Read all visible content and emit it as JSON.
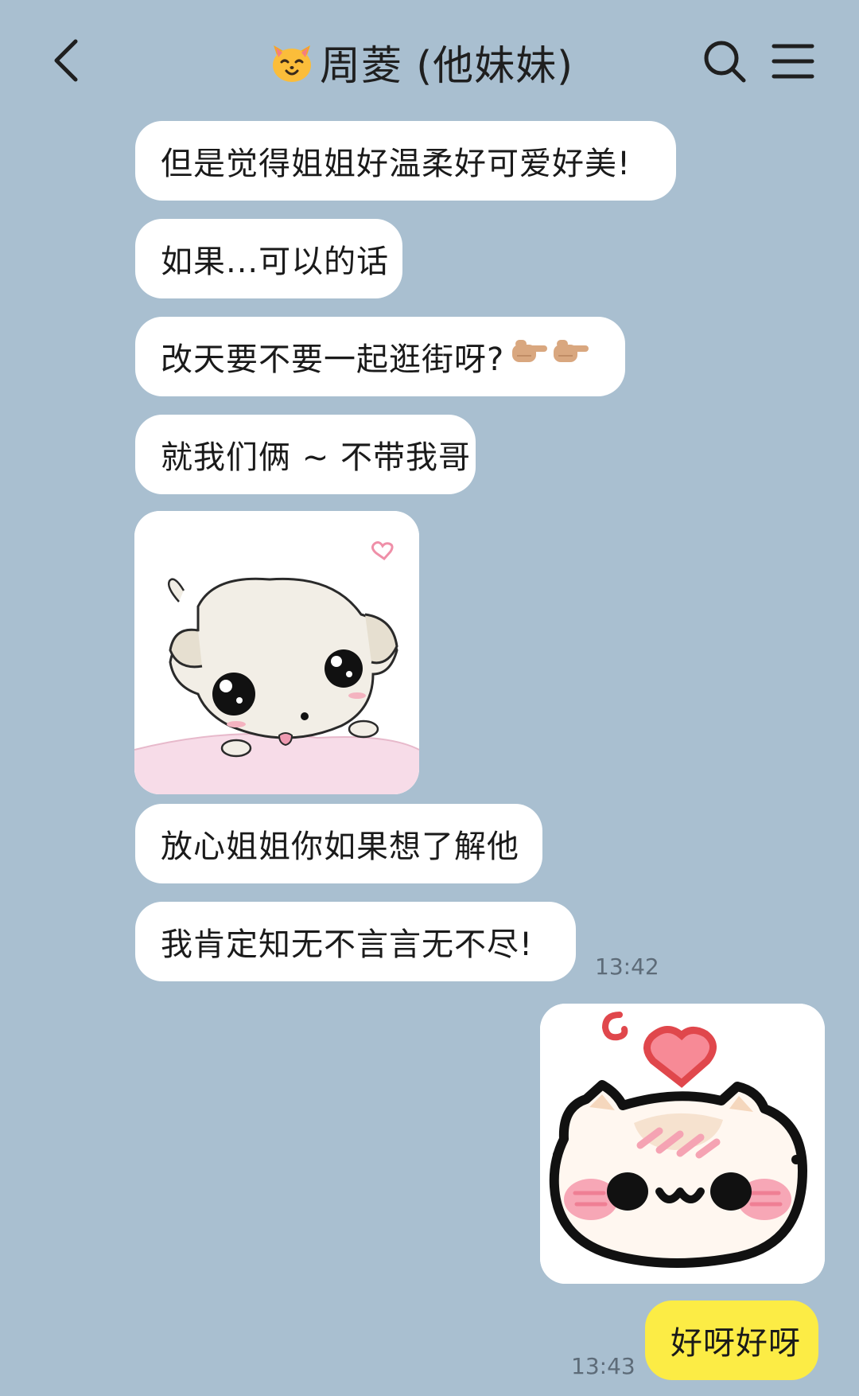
{
  "header": {
    "back_icon": "chevron-left-icon",
    "title_emoji": "cat-face-emoji",
    "title": "周菱 (他妹妹)",
    "search_icon": "search-icon",
    "menu_icon": "menu-icon"
  },
  "messages": [
    {
      "sender": "other",
      "type": "text",
      "text": "但是觉得姐姐好温柔好可爱好美!"
    },
    {
      "sender": "other",
      "type": "text",
      "text": "如果...可以的话"
    },
    {
      "sender": "other",
      "type": "text",
      "text": "改天要不要一起逛街呀?",
      "emoji": "pointing-fingers-emoji"
    },
    {
      "sender": "other",
      "type": "text",
      "text": "就我们俩 ~ 不带我哥"
    },
    {
      "sender": "other",
      "type": "sticker",
      "sticker": "cute-white-dog-sticker"
    },
    {
      "sender": "other",
      "type": "text",
      "text": "放心姐姐你如果想了解他"
    },
    {
      "sender": "other",
      "type": "text",
      "text": "我肯定知无不言言无不尽!",
      "time": "13:42"
    },
    {
      "sender": "self",
      "type": "sticker",
      "sticker": "blushing-cat-sticker"
    },
    {
      "sender": "self",
      "type": "text",
      "text": "好呀好呀",
      "time": "13:43"
    }
  ],
  "colors": {
    "background": "#a9bfd0",
    "bubble_other": "#ffffff",
    "bubble_self": "#fcec45"
  }
}
